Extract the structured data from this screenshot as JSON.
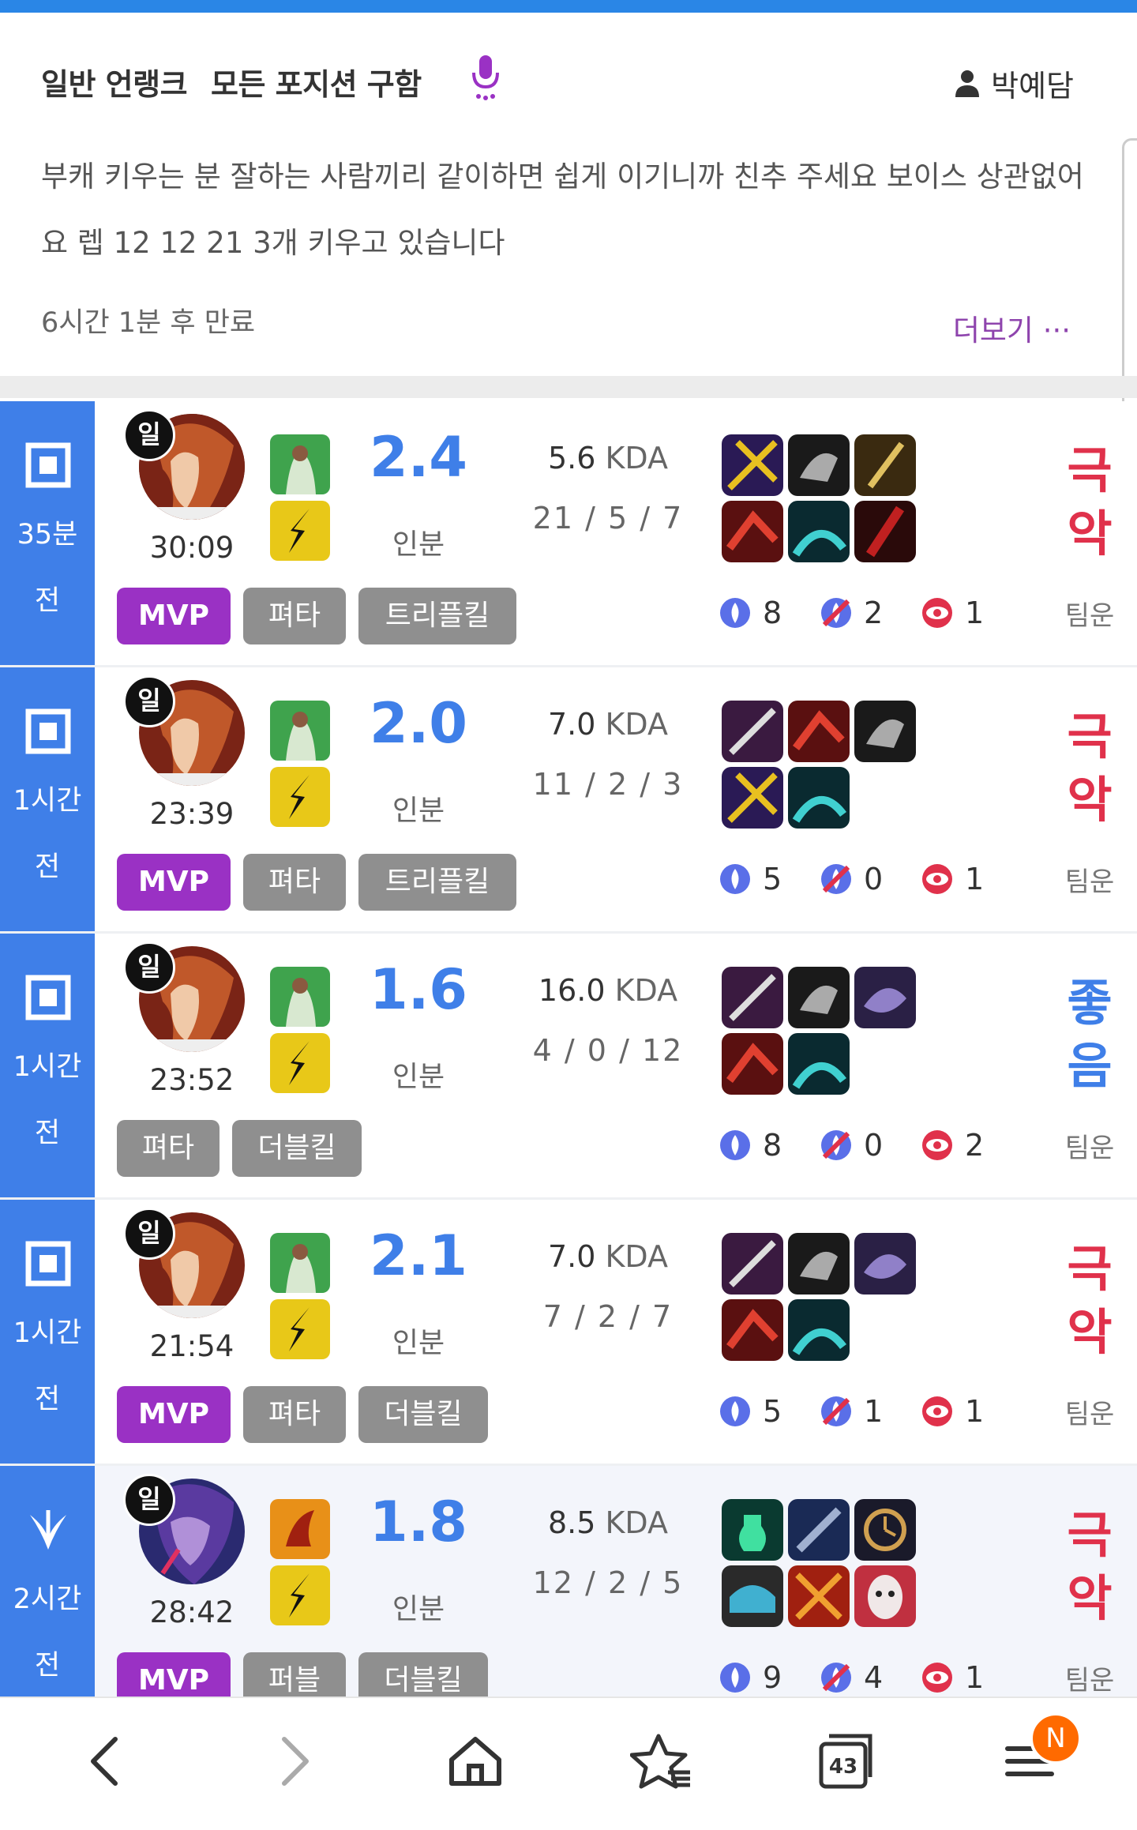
{
  "post": {
    "queue": "일반 언랭크",
    "recruit": "모든 포지션 구함",
    "author": "박예담",
    "description": "부캐 키우는 분 잘하는 사람끼리 같이하면 쉽게 이기니까 친추 주세요 보이스 상관없어요 렙 12 12 21 3개 키우고 있습니다",
    "expires": "6시간 1분 후 만료",
    "more": "더보기 ···"
  },
  "matches": [
    {
      "ago": "35분",
      "jeon": "전",
      "champ_badge": "일",
      "time": "30:09",
      "score": "2.4",
      "score_label": "인분",
      "kda_ratio": "5.6",
      "kda_unit": "KDA",
      "kda_line": "21 / 5 / 7",
      "badges": [
        "MVP",
        "펴타",
        "트리플킬"
      ],
      "wards": "8",
      "control": "2",
      "vision": "1",
      "verdict": "극악",
      "teamun": "팀운"
    },
    {
      "ago": "1시간",
      "jeon": "전",
      "champ_badge": "일",
      "time": "23:39",
      "score": "2.0",
      "score_label": "인분",
      "kda_ratio": "7.0",
      "kda_unit": "KDA",
      "kda_line": "11 / 2 / 3",
      "badges": [
        "MVP",
        "펴타",
        "트리플킬"
      ],
      "wards": "5",
      "control": "0",
      "vision": "1",
      "verdict": "극악",
      "teamun": "팀운"
    },
    {
      "ago": "1시간",
      "jeon": "전",
      "champ_badge": "일",
      "time": "23:52",
      "score": "1.6",
      "score_label": "인분",
      "kda_ratio": "16.0",
      "kda_unit": "KDA",
      "kda_line": "4 / 0 / 12",
      "badges": [
        "펴타",
        "더블킬"
      ],
      "wards": "8",
      "control": "0",
      "vision": "2",
      "verdict": "좋음",
      "teamun": "팀운"
    },
    {
      "ago": "1시간",
      "jeon": "전",
      "champ_badge": "일",
      "time": "21:54",
      "score": "2.1",
      "score_label": "인분",
      "kda_ratio": "7.0",
      "kda_unit": "KDA",
      "kda_line": "7 / 2 / 7",
      "badges": [
        "MVP",
        "펴타",
        "더블킬"
      ],
      "wards": "5",
      "control": "1",
      "vision": "1",
      "verdict": "극악",
      "teamun": "팀운"
    },
    {
      "ago": "2시간",
      "jeon": "전",
      "champ_badge": "일",
      "time": "28:42",
      "score": "1.8",
      "score_label": "인분",
      "kda_ratio": "8.5",
      "kda_unit": "KDA",
      "kda_line": "12 / 2 / 5",
      "badges": [
        "MVP",
        "퍼블",
        "더블킬"
      ],
      "wards": "9",
      "control": "4",
      "vision": "1",
      "verdict": "극악",
      "teamun": "팀운"
    }
  ],
  "nav": {
    "tabs_count": "43",
    "notification_badge": "N",
    "icons": [
      "back-icon",
      "forward-icon",
      "home-icon",
      "bookmarks-icon",
      "tabs-icon",
      "menu-icon"
    ]
  },
  "colors": {
    "accent_blue": "#3f7fe8",
    "mvp_purple": "#9a31c4",
    "bad_red": "#e0314b",
    "more_purple": "#8e44ad",
    "badge_orange": "#ff6a00"
  }
}
